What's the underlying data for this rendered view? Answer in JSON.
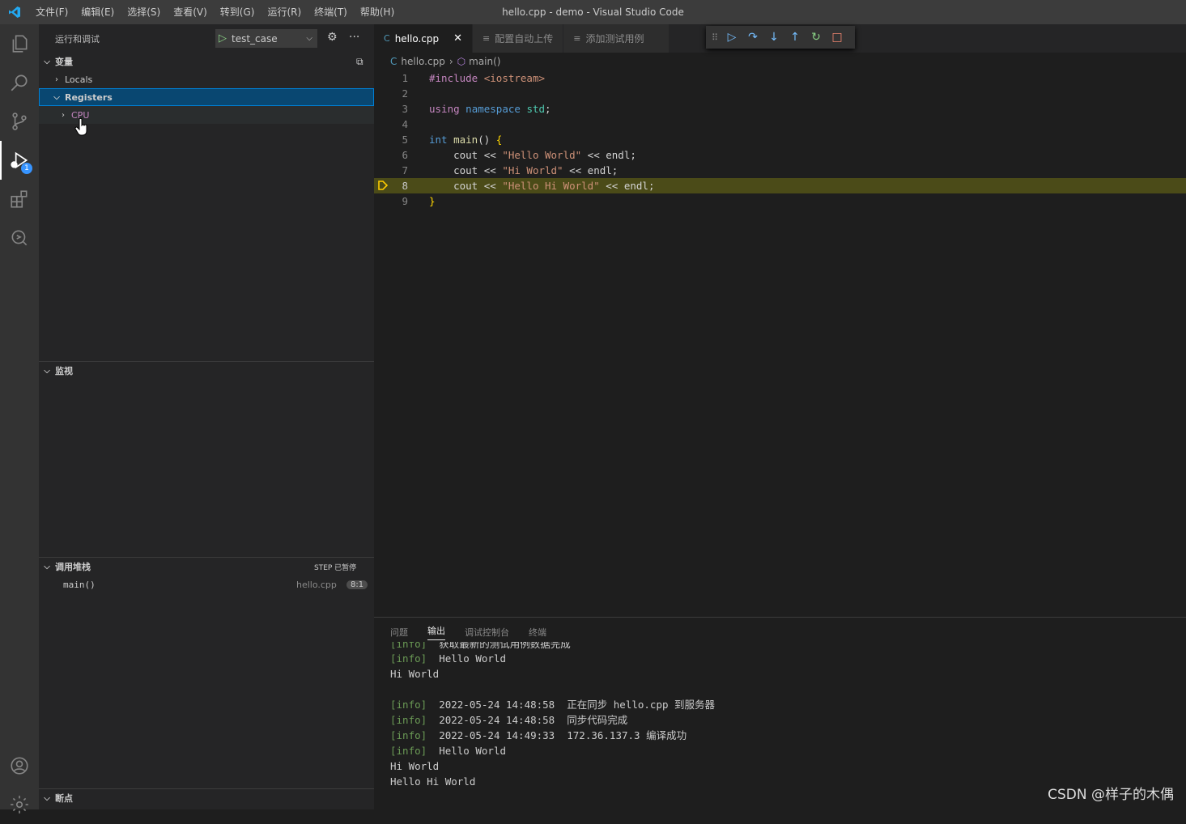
{
  "window": {
    "title": "hello.cpp - demo - Visual Studio Code"
  },
  "menu": [
    "文件(F)",
    "编辑(E)",
    "选择(S)",
    "查看(V)",
    "转到(G)",
    "运行(R)",
    "终端(T)",
    "帮助(H)"
  ],
  "activity_bar": {
    "items": [
      "explorer-icon",
      "search-icon",
      "source-control-icon",
      "run-debug-icon",
      "extensions-icon",
      "remote-icon"
    ],
    "debug_badge": "1",
    "bottom": [
      "account-icon",
      "settings-icon"
    ]
  },
  "sidebar": {
    "title": "运行和调试",
    "run_config": "test_case",
    "variables": {
      "header": "变量",
      "items": [
        {
          "label": "Locals",
          "expanded": false
        },
        {
          "label": "Registers",
          "expanded": true,
          "selected": true
        },
        {
          "label": "CPU",
          "expanded": false
        }
      ]
    },
    "watch": {
      "header": "监视"
    },
    "call_stack": {
      "header": "调用堆栈",
      "status": "STEP 已暂停",
      "frames": [
        {
          "name": "main()",
          "file": "hello.cpp",
          "position": "8:1"
        }
      ]
    },
    "breakpoints": {
      "header": "断点"
    }
  },
  "editor": {
    "tabs": [
      {
        "label": "hello.cpp",
        "active": true
      },
      {
        "label": "配置自动上传",
        "active": false
      },
      {
        "label": "添加测试用例",
        "active": false
      }
    ],
    "debug_toolbar": [
      "drag-icon",
      "continue-icon",
      "step-over-icon",
      "step-into-icon",
      "step-out-icon",
      "restart-icon",
      "stop-icon"
    ],
    "breadcrumb": {
      "file": "hello.cpp",
      "symbol": "main()"
    },
    "current_line": 8,
    "lines": [
      {
        "n": "1",
        "text": "#include <iostream>"
      },
      {
        "n": "2",
        "text": ""
      },
      {
        "n": "3",
        "text": "using namespace std;"
      },
      {
        "n": "4",
        "text": ""
      },
      {
        "n": "5",
        "text": "int main() {"
      },
      {
        "n": "6",
        "text": "    cout << \"Hello World\" << endl;"
      },
      {
        "n": "7",
        "text": "    cout << \"Hi World\" << endl;"
      },
      {
        "n": "8",
        "text": "    cout << \"Hello Hi World\" << endl;"
      },
      {
        "n": "9",
        "text": "}"
      }
    ]
  },
  "panel": {
    "tabs": [
      "问题",
      "输出",
      "调试控制台",
      "终端"
    ],
    "active_tab": "输出",
    "output": [
      {
        "tag": "[info]",
        "text": "  获取最新的测试用例数据完成"
      },
      {
        "tag": "[info]",
        "text": "  Hello World"
      },
      {
        "tag": "",
        "text": "Hi World"
      },
      {
        "tag": "",
        "text": ""
      },
      {
        "tag": "[info]",
        "text": "  2022-05-24 14:48:58  正在同步 hello.cpp 到服务器"
      },
      {
        "tag": "[info]",
        "text": "  2022-05-24 14:48:58  同步代码完成"
      },
      {
        "tag": "[info]",
        "text": "  2022-05-24 14:49:33  172.36.137.3 编译成功"
      },
      {
        "tag": "[info]",
        "text": "  Hello World"
      },
      {
        "tag": "",
        "text": "Hi World"
      },
      {
        "tag": "",
        "text": "Hello Hi World"
      }
    ]
  },
  "watermark": "CSDN @样子的木偶",
  "colors": {
    "accent": "#007acc",
    "selection": "#094771",
    "current_line": "#4b4b18",
    "breakpoint": "#ffcc00"
  }
}
